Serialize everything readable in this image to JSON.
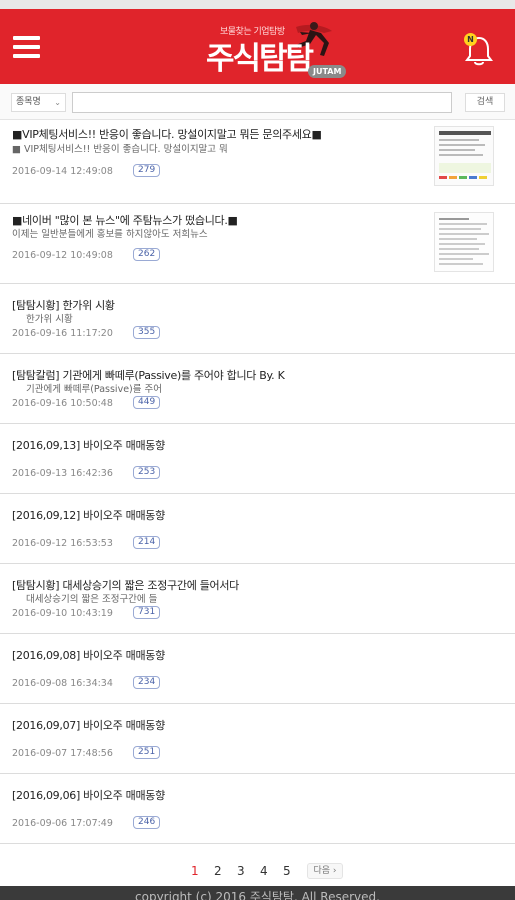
{
  "header": {
    "logo_slogan": "보물찾는 기업탐방",
    "logo_text": "주식탐탐",
    "logo_badge": "JUTAM",
    "notification_badge": "N",
    "brand_color": "#e0242b"
  },
  "search": {
    "select_value": "종목명",
    "input_value": "",
    "button_label": "검색"
  },
  "items": [
    {
      "title": "■VIP체팅서비스!! 반응이 좋습니다. 망설이지말고 뭐든 문의주세요■",
      "sub": "■ VIP체팅서비스!! 반응이 좋습니다. 망설이지말고 뭐",
      "date": "2016-09-14 12:49:08",
      "count": "279",
      "thumb": "chat-screenshot"
    },
    {
      "title": "■네이버 \"많이 본 뉴스\"에 주탐뉴스가 떴습니다.■",
      "sub": "이제는 일반분들에게 홍보를 하지않아도 저희뉴스",
      "date": "2016-09-12 10:49:08",
      "count": "262",
      "thumb": "news-screenshot"
    },
    {
      "title": "[탐탐시황] 한가위 시황",
      "sub": "한가위 시황",
      "date": "2016-09-16 11:17:20",
      "count": "355"
    },
    {
      "title": "[탐탐칼럼] 기관에게 빠떼루(Passive)를 주어야 합니다 By. K",
      "sub": "기관에게 빠떼루(Passive)를 주어",
      "date": "2016-09-16 10:50:48",
      "count": "449"
    },
    {
      "title": "[2016,09,13] 바이오주 매매동향",
      "sub": "",
      "date": "2016-09-13 16:42:36",
      "count": "253"
    },
    {
      "title": "[2016,09,12] 바이오주 매매동향",
      "sub": "",
      "date": "2016-09-12 16:53:53",
      "count": "214"
    },
    {
      "title": "[탐탐시황] 대세상승기의 짧은 조정구간에 들어서다",
      "sub": "대세상승기의 짧은 조정구간에 들",
      "date": "2016-09-10 10:43:19",
      "count": "731"
    },
    {
      "title": "[2016,09,08] 바이오주 매매동향",
      "sub": "",
      "date": "2016-09-08 16:34:34",
      "count": "234"
    },
    {
      "title": "[2016,09,07] 바이오주 매매동향",
      "sub": "",
      "date": "2016-09-07 17:48:56",
      "count": "251"
    },
    {
      "title": "[2016,09,06] 바이오주 매매동향",
      "sub": "",
      "date": "2016-09-06 17:07:49",
      "count": "246"
    }
  ],
  "pagination": {
    "pages": [
      "1",
      "2",
      "3",
      "4",
      "5"
    ],
    "current": "1",
    "next_label": "다음 ›"
  },
  "footer": {
    "text": "copyright (c) 2016 주식탐탐. All Reserved."
  }
}
